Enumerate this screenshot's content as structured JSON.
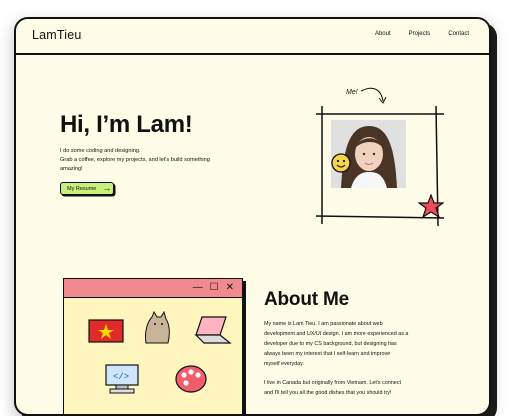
{
  "nav": {
    "logo": "LamTieu",
    "links": [
      "About",
      "Projects",
      "Contact"
    ]
  },
  "hero": {
    "title": "Hi, I’m Lam!",
    "lines": [
      "I do some coding and designing.",
      "Grab a coffee, explore my projects, and let's build something",
      "amazing!"
    ],
    "resume_label": "My Resume",
    "me_label": "Me!"
  },
  "about": {
    "title": "About Me",
    "para1": [
      "My name is Lam Tieu. I am passionate about web",
      "development and UX/UI design. I am more experienced as a",
      "developer due to my CS background, but designing has",
      "always been my interest that I self-learn and improve",
      "myself everyday."
    ],
    "para2": [
      "I live in Canada but originally from Vietnam. Let's connect",
      "and I'll tell you all the good dishes that you should try!"
    ],
    "window_controls": [
      "—",
      "☐",
      "✕"
    ]
  },
  "colors": {
    "background": "#fffde7",
    "accent_green": "#c8f07a",
    "window_bar": "#f08a8e",
    "window_body": "#fff6bf"
  }
}
